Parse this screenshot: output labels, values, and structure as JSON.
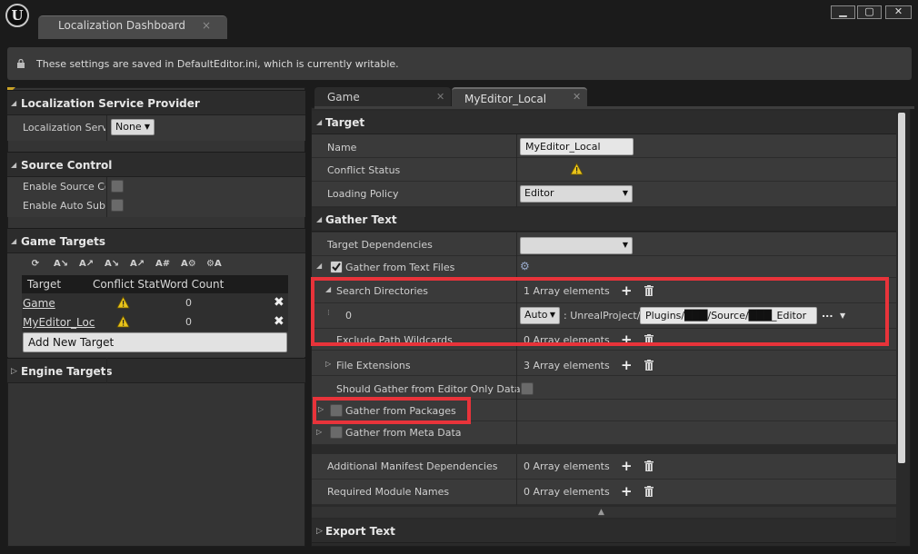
{
  "window": {
    "tab_title": "Localization Dashboard",
    "tab_close": "×",
    "minimize": "▁",
    "maximize": "▢",
    "close": "✕"
  },
  "info_bar": {
    "message": "These settings are saved in DefaultEditor.ini, which is currently writable."
  },
  "left": {
    "service_provider": {
      "title": "Localization Service Provider",
      "label": "Localization Servi",
      "value": "None"
    },
    "source_control": {
      "title": "Source Control",
      "enable_label": "Enable Source Cor",
      "auto_submit_label": "Enable Auto Subm"
    },
    "game_targets": {
      "title": "Game Targets",
      "columns": [
        "Target",
        "Conflict Stat",
        "Word Count"
      ],
      "rows": [
        {
          "name": "Game",
          "word_count": "0"
        },
        {
          "name": "MyEditor_Loc",
          "word_count": "0"
        }
      ],
      "add_button": "Add New Target"
    },
    "engine_targets": {
      "title": "Engine Targets"
    }
  },
  "right": {
    "tabs": [
      {
        "label": "Game"
      },
      {
        "label": "MyEditor_Local"
      }
    ],
    "target": {
      "title": "Target",
      "name_label": "Name",
      "name_value": "MyEditor_Local",
      "conflict_label": "Conflict Status",
      "loading_label": "Loading Policy",
      "loading_value": "Editor"
    },
    "gather_text": {
      "title": "Gather Text",
      "target_deps_label": "Target Dependencies",
      "gather_text_files_label": "Gather from Text Files",
      "search_dirs_label": "Search Directories",
      "search_dirs_count": "1 Array elements",
      "index_0": "0",
      "path_root_mode": "Auto",
      "path_prefix": ": UnrealProject/",
      "path_value": "Plugins/███/Source/███_Editor",
      "ellipsis": "...",
      "exclude_label": "Exclude Path Wildcards",
      "exclude_count": "0 Array elements",
      "file_ext_label": "File Extensions",
      "file_ext_count": "3 Array elements",
      "editor_only_label": "Should Gather from Editor Only Data",
      "packages_label": "Gather from Packages",
      "metadata_label": "Gather from Meta Data",
      "manifest_label": "Additional Manifest Dependencies",
      "manifest_count": "0 Array elements",
      "modules_label": "Required Module Names",
      "modules_count": "0 Array elements"
    },
    "export_text": {
      "title": "Export Text"
    }
  },
  "colors": {
    "accent_red": "#e8333a",
    "warning": "#e8c31a",
    "panel": "#3a3a3a"
  }
}
